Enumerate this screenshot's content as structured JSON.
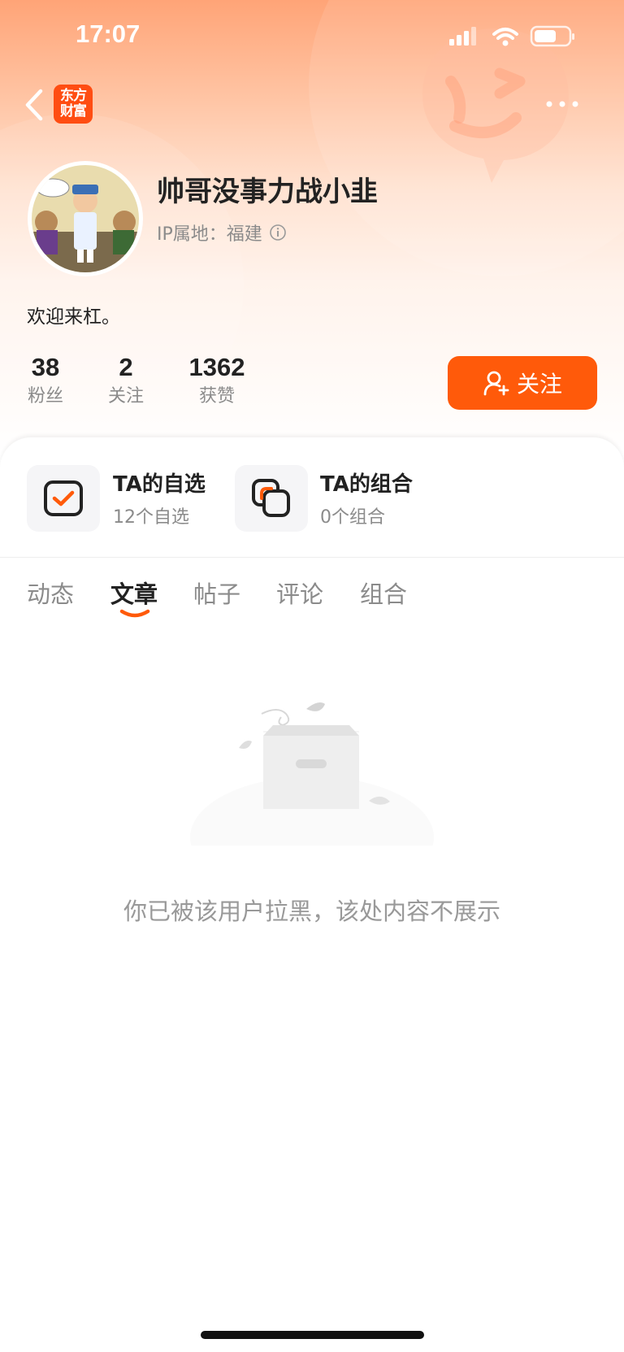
{
  "status_bar": {
    "time": "17:07"
  },
  "header": {
    "logo_text_line1": "东方",
    "logo_text_line2": "财富",
    "back_icon": "chevron-left-icon",
    "more_icon": "more-dots-icon"
  },
  "profile": {
    "username": "帅哥没事力战小韭",
    "ip_location": "IP属地：福建",
    "bio": "欢迎来杠。",
    "stats": [
      {
        "value": "38",
        "label": "粉丝"
      },
      {
        "value": "2",
        "label": "关注"
      },
      {
        "value": "1362",
        "label": "获赞"
      }
    ],
    "follow_label": "关注"
  },
  "cards": [
    {
      "title": "TA的自选",
      "subtitle": "12个自选",
      "icon": "checkbox-icon"
    },
    {
      "title": "TA的组合",
      "subtitle": "0个组合",
      "icon": "portfolio-icon"
    }
  ],
  "tabs": [
    {
      "label": "动态",
      "active": false
    },
    {
      "label": "文章",
      "active": true
    },
    {
      "label": "帖子",
      "active": false
    },
    {
      "label": "评论",
      "active": false
    },
    {
      "label": "组合",
      "active": false
    }
  ],
  "empty_state": {
    "message": "你已被该用户拉黑，该处内容不展示"
  },
  "colors": {
    "accent": "#ff5a0a",
    "logo": "#ff4d12",
    "muted_text": "#8b8b8b"
  }
}
